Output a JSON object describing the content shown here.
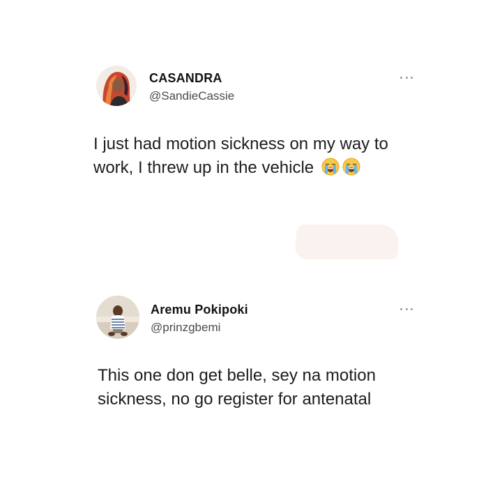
{
  "tweets": [
    {
      "display_name": "CASANDRA",
      "handle": "@SandieCassie",
      "text": "I just had motion sickness on my way to work, I threw up in the vehicle",
      "emojis": [
        "loudly-crying-face",
        "loudly-crying-face"
      ]
    },
    {
      "display_name": "Aremu Pokipoki",
      "handle": "@prinzgbemi",
      "text": "This one don get belle, sey na motion sickness, no go register for antenatal"
    }
  ]
}
